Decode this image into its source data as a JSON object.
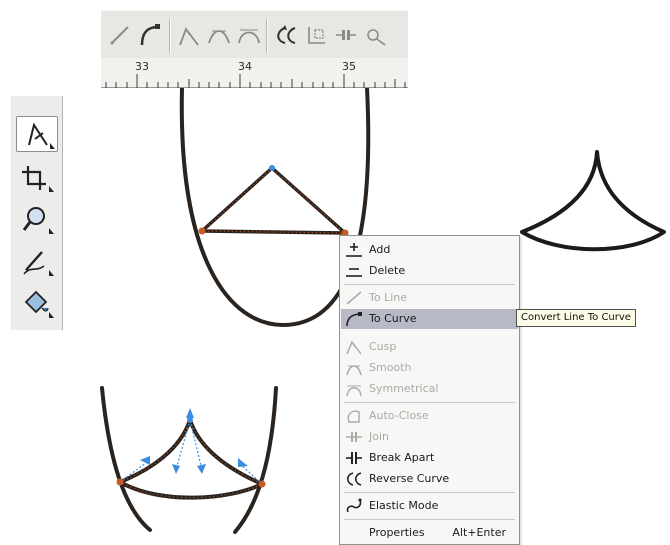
{
  "ruler": {
    "labels": [
      "33",
      "34",
      "35"
    ]
  },
  "toolbar": {
    "icons": [
      "to-line-icon",
      "to-curve-icon",
      "cusp-icon",
      "smooth-icon",
      "symmetrical-icon",
      "reverse-curve-icon",
      "extract-subpath-icon",
      "extend-curve-icon",
      "auto-reduce-icon"
    ]
  },
  "toolbox": {
    "tools": [
      "shape-tool",
      "crop-tool",
      "zoom-tool",
      "freehand-tool",
      "fill-tool"
    ],
    "active_tool": "shape-tool"
  },
  "context_menu": {
    "items": [
      {
        "label": "Add",
        "icon": "add-node-icon",
        "enabled": true
      },
      {
        "label": "Delete",
        "icon": "delete-node-icon",
        "enabled": true
      },
      {
        "label": "To Line",
        "icon": "to-line-icon",
        "enabled": false
      },
      {
        "label": "To Curve",
        "icon": "to-curve-icon",
        "enabled": true,
        "highlighted": true
      },
      {
        "label": "Cusp",
        "icon": "cusp-icon",
        "enabled": false
      },
      {
        "label": "Smooth",
        "icon": "smooth-icon",
        "enabled": false
      },
      {
        "label": "Symmetrical",
        "icon": "symmetrical-icon",
        "enabled": false
      },
      {
        "label": "Auto-Close",
        "icon": "auto-close-icon",
        "enabled": false
      },
      {
        "label": "Join",
        "icon": "join-icon",
        "enabled": false
      },
      {
        "label": "Break Apart",
        "icon": "break-apart-icon",
        "enabled": true
      },
      {
        "label": "Reverse Curve",
        "icon": "reverse-curve-icon",
        "enabled": true
      },
      {
        "label": "Elastic Mode",
        "icon": "elastic-mode-icon",
        "enabled": true
      },
      {
        "label": "Properties",
        "shortcut": "Alt+Enter",
        "enabled": true
      }
    ]
  },
  "tooltip": {
    "text": "Convert Line To Curve"
  },
  "colors": {
    "curve": "#2b231d",
    "node": "#c85a28",
    "selected_node": "#3c8ce0",
    "menu_highlight": "#b8b9c7"
  }
}
